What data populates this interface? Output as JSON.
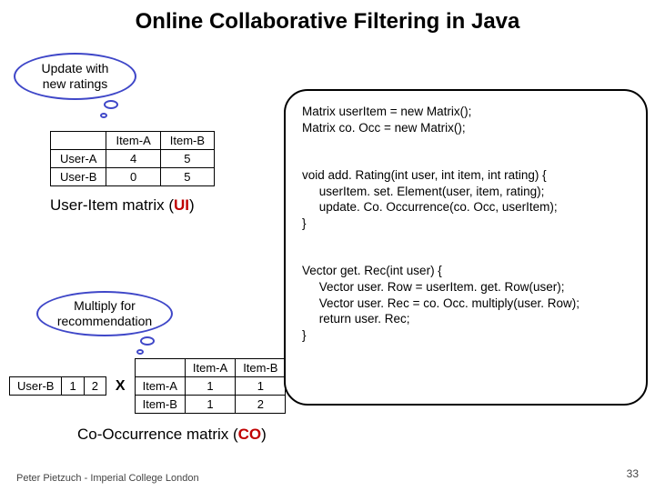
{
  "title": "Online Collaborative Filtering in Java",
  "bubble1": "Update with\nnew ratings",
  "bubble2": "Multiply for\nrecommendation",
  "ui_table": {
    "cols": [
      "",
      "Item-A",
      "Item-B"
    ],
    "rows": [
      [
        "User-A",
        "4",
        "5"
      ],
      [
        "User-B",
        "0",
        "5"
      ]
    ]
  },
  "ui_caption_prefix": "User-Item matrix (",
  "ui_caption_red": "UI",
  "ui_caption_suffix": ")",
  "vector": {
    "label": "User-B",
    "values": [
      "1",
      "2"
    ]
  },
  "x_symbol": "X",
  "co_table": {
    "cols": [
      "",
      "Item-A",
      "Item-B"
    ],
    "rows": [
      [
        "Item-A",
        "1",
        "1"
      ],
      [
        "Item-B",
        "1",
        "2"
      ]
    ]
  },
  "co_caption_prefix": "Co-Occurrence matrix (",
  "co_caption_red": "CO",
  "co_caption_suffix": ")",
  "code": "Matrix userItem = new Matrix();\nMatrix co. Occ = new Matrix();\n\n\nvoid add. Rating(int user, int item, int rating) {\n     userItem. set. Element(user, item, rating);\n     update. Co. Occurrence(co. Occ, userItem);\n}\n\n\nVector get. Rec(int user) {\n     Vector user. Row = userItem. get. Row(user);\n     Vector user. Rec = co. Occ. multiply(user. Row);\n     return user. Rec;\n}",
  "footer": "Peter Pietzuch - Imperial College London",
  "pagenum": "33"
}
